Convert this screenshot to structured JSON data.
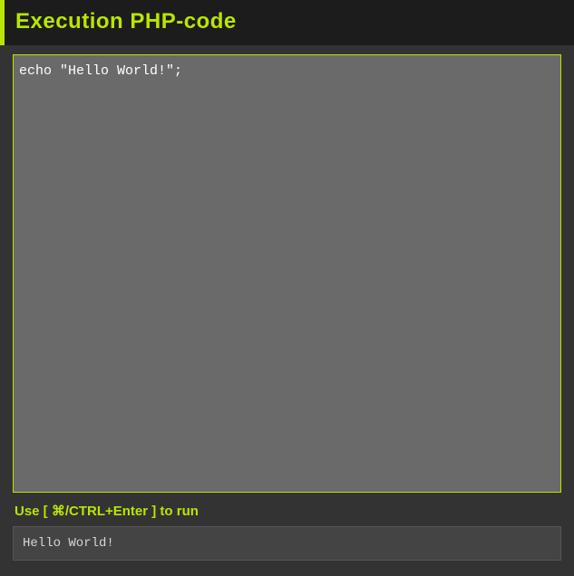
{
  "header": {
    "title": "Execution PHP-code"
  },
  "editor": {
    "code": "echo \"Hello World!\";"
  },
  "hint": {
    "text": "Use [ ⌘/CTRL+Enter ] to run"
  },
  "output": {
    "text": "Hello World!"
  },
  "colors": {
    "accent": "#b8e600",
    "header_bg": "#1c1c1c",
    "body_bg": "#333333",
    "editor_bg": "#6a6a6a",
    "output_bg": "#444444"
  }
}
